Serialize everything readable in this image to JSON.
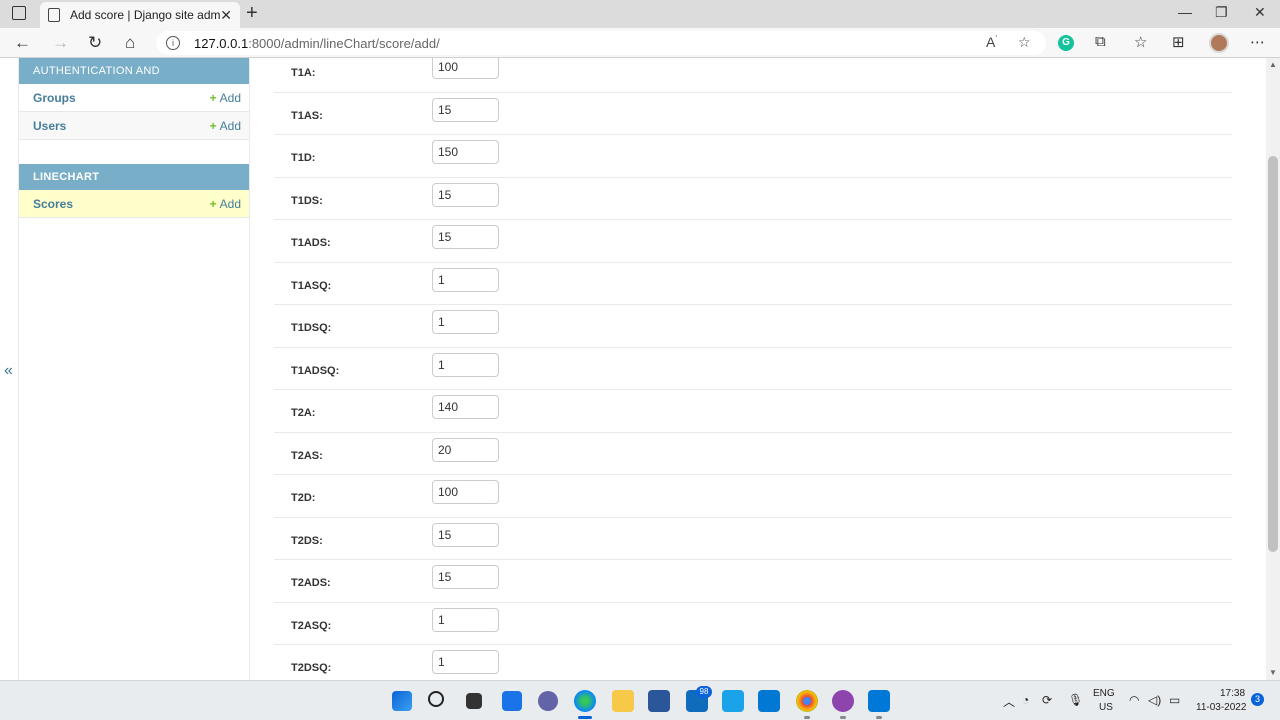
{
  "browser": {
    "tab_title": "Add score | Django site admin",
    "url_host": "127.0.0.1",
    "url_path": ":8000/admin/lineChart/score/add/"
  },
  "sidebar": {
    "modules": [
      {
        "caption": "AUTHENTICATION AND AUTHORIZATION",
        "rows": [
          {
            "name": "Groups",
            "add": "Add"
          },
          {
            "name": "Users",
            "add": "Add"
          }
        ]
      },
      {
        "caption": "LINECHART",
        "rows": [
          {
            "name": "Scores",
            "add": "Add"
          }
        ]
      }
    ]
  },
  "form": {
    "fields": [
      {
        "label": "T1A:",
        "value": "100"
      },
      {
        "label": "T1AS:",
        "value": "15"
      },
      {
        "label": "T1D:",
        "value": "150"
      },
      {
        "label": "T1DS:",
        "value": "15"
      },
      {
        "label": "T1ADS:",
        "value": "15"
      },
      {
        "label": "T1ASQ:",
        "value": "1"
      },
      {
        "label": "T1DSQ:",
        "value": "1"
      },
      {
        "label": "T1ADSQ:",
        "value": "1"
      },
      {
        "label": "T2A:",
        "value": "140"
      },
      {
        "label": "T2AS:",
        "value": "20"
      },
      {
        "label": "T2D:",
        "value": "100"
      },
      {
        "label": "T2DS:",
        "value": "15"
      },
      {
        "label": "T2ADS:",
        "value": "15"
      },
      {
        "label": "T2ASQ:",
        "value": "1"
      },
      {
        "label": "T2DSQ:",
        "value": "1"
      }
    ]
  },
  "taskbar": {
    "mail_badge": "98",
    "lang": "ENG",
    "region": "US",
    "time": "17:38",
    "date": "11-03-2022",
    "notifications": "3"
  },
  "colors": {
    "module_caption": "#79aec8",
    "link": "#447e9b",
    "current_row": "#ffffcc",
    "add_plus": "#70bf2b"
  }
}
